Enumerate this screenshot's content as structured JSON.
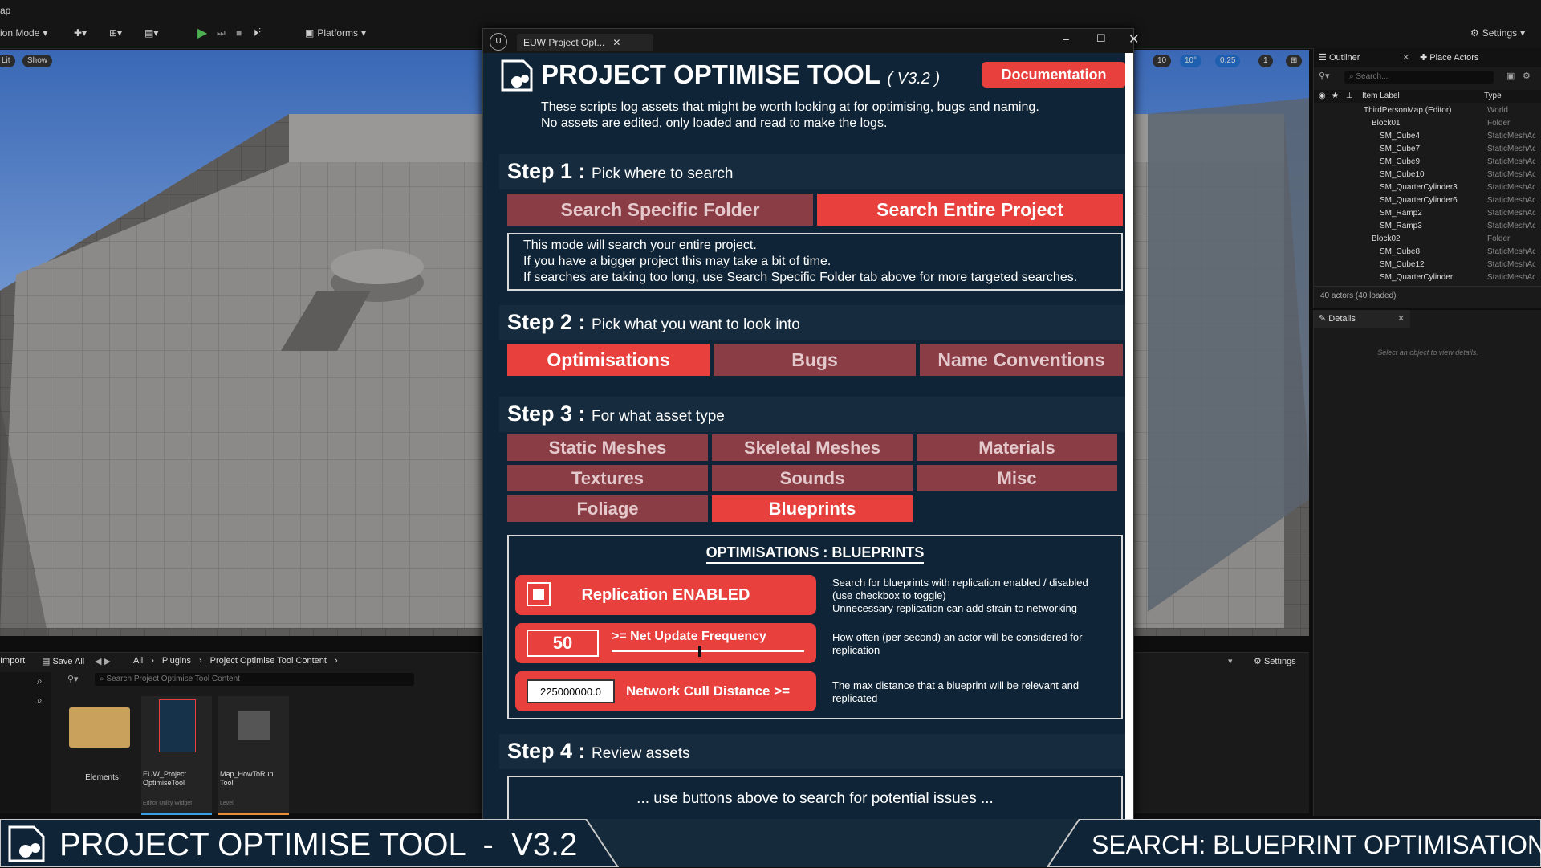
{
  "editor": {
    "mode_label": "ion Mode",
    "map_label": "ap",
    "platforms_label": "Platforms",
    "settings_label": "Settings",
    "viewport_chips": [
      "Lit",
      "Show"
    ],
    "viewport_right": [
      "10",
      "10°",
      "0.25",
      "1"
    ]
  },
  "outliner": {
    "tab_label": "Outliner",
    "place_actors_label": "Place Actors",
    "search_placeholder": "Search...",
    "col_label": "Item Label",
    "col_type": "Type",
    "rows": [
      {
        "label": "ThirdPersonMap (Editor)",
        "type": "World",
        "indent": 0
      },
      {
        "label": "Block01",
        "type": "Folder",
        "indent": 1
      },
      {
        "label": "SM_Cube4",
        "type": "StaticMeshActor",
        "indent": 2
      },
      {
        "label": "SM_Cube7",
        "type": "StaticMeshActor",
        "indent": 2
      },
      {
        "label": "SM_Cube9",
        "type": "StaticMeshActor",
        "indent": 2
      },
      {
        "label": "SM_Cube10",
        "type": "StaticMeshActor",
        "indent": 2
      },
      {
        "label": "SM_QuarterCylinder3",
        "type": "StaticMeshActor",
        "indent": 2
      },
      {
        "label": "SM_QuarterCylinder6",
        "type": "StaticMeshActor",
        "indent": 2
      },
      {
        "label": "SM_Ramp2",
        "type": "StaticMeshActor",
        "indent": 2
      },
      {
        "label": "SM_Ramp3",
        "type": "StaticMeshActor",
        "indent": 2
      },
      {
        "label": "Block02",
        "type": "Folder",
        "indent": 1
      },
      {
        "label": "SM_Cube8",
        "type": "StaticMeshActor",
        "indent": 2
      },
      {
        "label": "SM_Cube12",
        "type": "StaticMeshActor",
        "indent": 2
      },
      {
        "label": "SM_QuarterCylinder",
        "type": "StaticMeshActor",
        "indent": 2
      }
    ],
    "actor_count": "40 actors (40 loaded)"
  },
  "details": {
    "tab_label": "Details",
    "empty_text": "Select an object to view details."
  },
  "content": {
    "import_label": "Import",
    "save_all_label": "Save All",
    "breadcrumb": [
      "All",
      "Plugins",
      "Project Optimise Tool Content"
    ],
    "search_placeholder": "Search Project Optimise Tool Content",
    "settings_label": "Settings",
    "assets": [
      {
        "name": "Elements",
        "type": ""
      },
      {
        "name": "EUW_Project OptimiseTool",
        "type": "Editor Utility Widget"
      },
      {
        "name": "Map_HowToRun Tool",
        "type": "Level"
      }
    ]
  },
  "tool": {
    "tab_title": "EUW Project Opt...",
    "title": "PROJECT OPTIMISE TOOL",
    "version": "( V3.2 )",
    "doc_button": "Documentation",
    "intro_1": "These scripts log assets that might be worth looking at for optimising, bugs and naming.",
    "intro_2": "No assets are edited, only loaded and read to make the logs.",
    "step1": {
      "head": "Step 1 :",
      "sub": "Pick where to search",
      "btn_folder": "Search Specific Folder",
      "btn_project": "Search Entire Project",
      "info": [
        "This mode will search your entire project.",
        "If you have a bigger project this may take a bit of time.",
        "If searches are taking too long, use Search Specific Folder tab above for more targeted searches."
      ]
    },
    "step2": {
      "head": "Step 2 :",
      "sub": "Pick what you want to look into",
      "buttons": [
        "Optimisations",
        "Bugs",
        "Name Conventions"
      ]
    },
    "step3": {
      "head": "Step 3 :",
      "sub": "For what asset type",
      "buttons": [
        "Static Meshes",
        "Skeletal Meshes",
        "Materials",
        "Textures",
        "Sounds",
        "Misc",
        "Foliage",
        "Blueprints"
      ]
    },
    "options": {
      "title": "OPTIMISATIONS : BLUEPRINTS",
      "replication_label": "Replication ENABLED",
      "replication_desc": [
        "Search for blueprints with replication enabled / disabled",
        "(use checkbox to toggle)",
        "Unnecessary replication can add strain to networking"
      ],
      "net_value": "50",
      "net_label": ">= Net Update Frequency",
      "net_slider": 0.45,
      "net_desc": [
        "How often (per second) an actor will be considered for",
        "replication"
      ],
      "cull_value": "225000000.0",
      "cull_label": "Network Cull Distance >=",
      "cull_desc": [
        "The max distance that a blueprint will be relevant and",
        "replicated"
      ]
    },
    "step4": {
      "head": "Step 4 :",
      "sub": "Review assets",
      "result": "... use buttons above to search for potential issues ..."
    }
  },
  "banner": {
    "left": "PROJECT OPTIMISE TOOL  -  V3.2",
    "right": "SEARCH: BLUEPRINT OPTIMISATIONS"
  },
  "colors": {
    "accent": "#e8403c",
    "inactive": "#8a3d45",
    "panel": "#0f2537"
  }
}
